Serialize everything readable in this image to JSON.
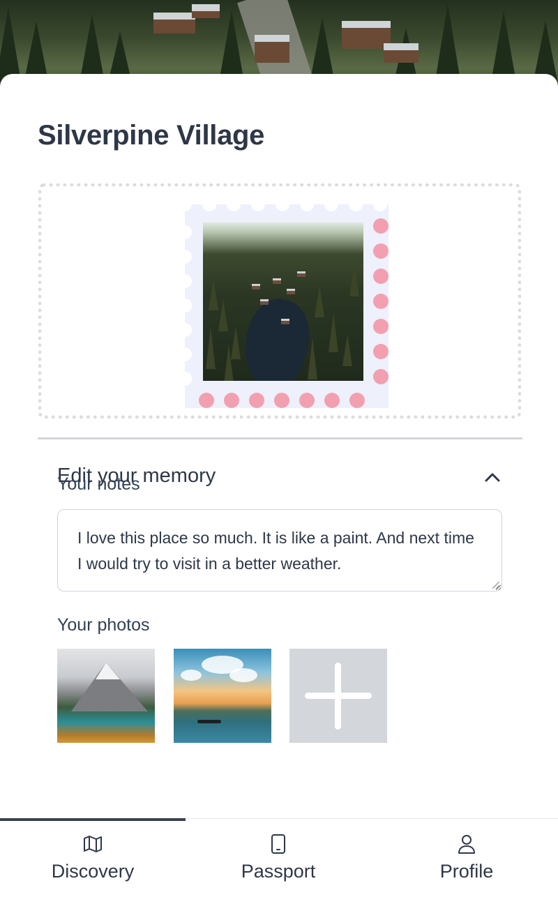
{
  "place": {
    "title": "Silverpine Village"
  },
  "memory": {
    "section_title": "Edit your memory",
    "notes_label": "Your notes",
    "notes_text": "I love this place so much. It is like a paint. And next time I would try to visit in a better weather.",
    "photos_label": "Your photos",
    "photos": [
      {
        "name": "mountain-lake-photo"
      },
      {
        "name": "sunset-lake-boat-photo"
      }
    ],
    "add_photo_icon": "plus-icon",
    "toggle_icon": "chevron-up-icon"
  },
  "nav": {
    "items": [
      {
        "label": "Discovery",
        "icon": "map-icon",
        "active": true
      },
      {
        "label": "Passport",
        "icon": "phone-icon",
        "active": false
      },
      {
        "label": "Profile",
        "icon": "user-icon",
        "active": false
      }
    ]
  },
  "colors": {
    "title": "#2e3748",
    "stamp_background": "#eef0fb",
    "stamp_perforation_accent": "#f2a0b0",
    "add_photo_tile": "#d3d6db",
    "active_tab_indicator": "#3a4150"
  }
}
